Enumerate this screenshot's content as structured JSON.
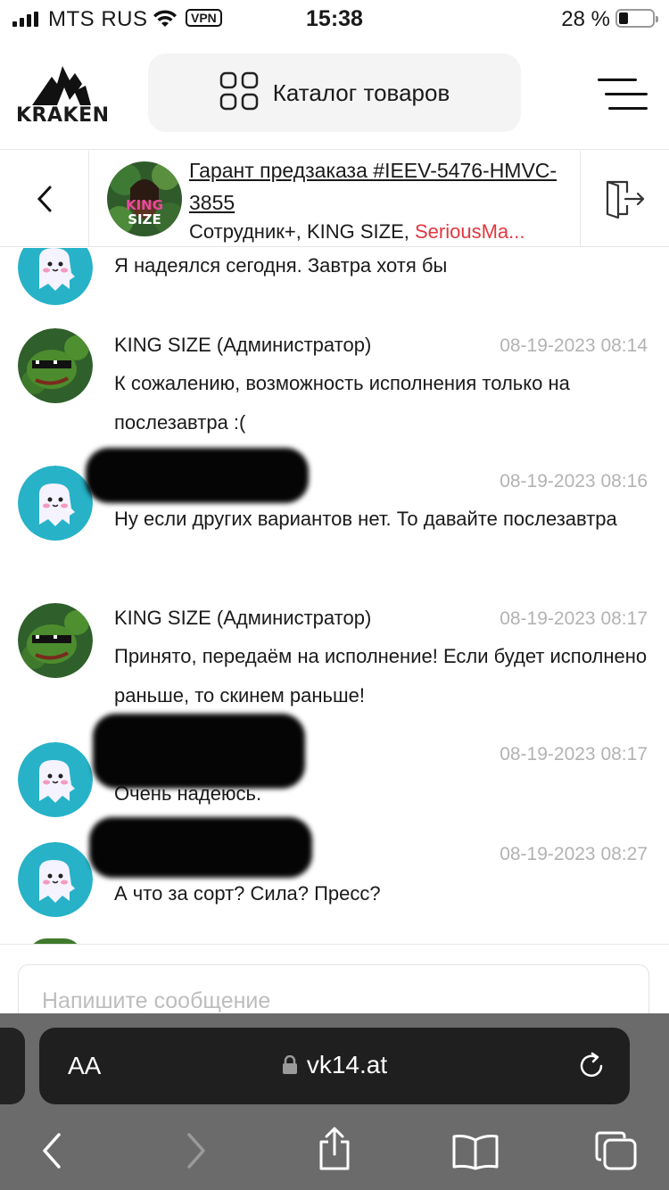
{
  "status_bar": {
    "carrier": "MTS RUS",
    "vpn": "VPN",
    "time": "15:38",
    "battery": "28 %"
  },
  "header": {
    "logo_text": "KRAKEN",
    "catalog_label": "Каталог товаров"
  },
  "chat": {
    "title": "Гарант предзаказа #IEEV-5476-HMVC-3855",
    "members_prefix": "Сотрудник+, KING SIZE, ",
    "members_highlight": "SeriousMa..."
  },
  "messages": [
    {
      "author": "",
      "time": "",
      "text": "Я надеялся сегодня. Завтра хотя бы",
      "avatar": "ghost-avatar"
    },
    {
      "author": "KING SIZE (Администратор)",
      "time": "08-19-2023 08:14",
      "text": "К сожалению, возможность исполнения только на послезавтра :(",
      "avatar": "frog-avatar"
    },
    {
      "author": "",
      "time": "08-19-2023 08:16",
      "text": "Ну если других вариантов нет. То давайте послезавтра",
      "avatar": "ghost-avatar"
    },
    {
      "author": "KING SIZE (Администратор)",
      "time": "08-19-2023 08:17",
      "text": "Принято, передаём на исполнение! Если будет исполнено раньше, то скинем раньше!",
      "avatar": "frog-avatar"
    },
    {
      "author": "",
      "time": "08-19-2023 08:17",
      "text": "Очень надеюсь.",
      "avatar": "ghost-avatar"
    },
    {
      "author": "",
      "time": "08-19-2023 08:27",
      "text": "А что за сорт? Сила? Пресс?",
      "avatar": "ghost-avatar"
    }
  ],
  "input": {
    "placeholder": "Напишите сообщение"
  },
  "browser": {
    "aa_label": "AA",
    "url": "vk14.at"
  }
}
